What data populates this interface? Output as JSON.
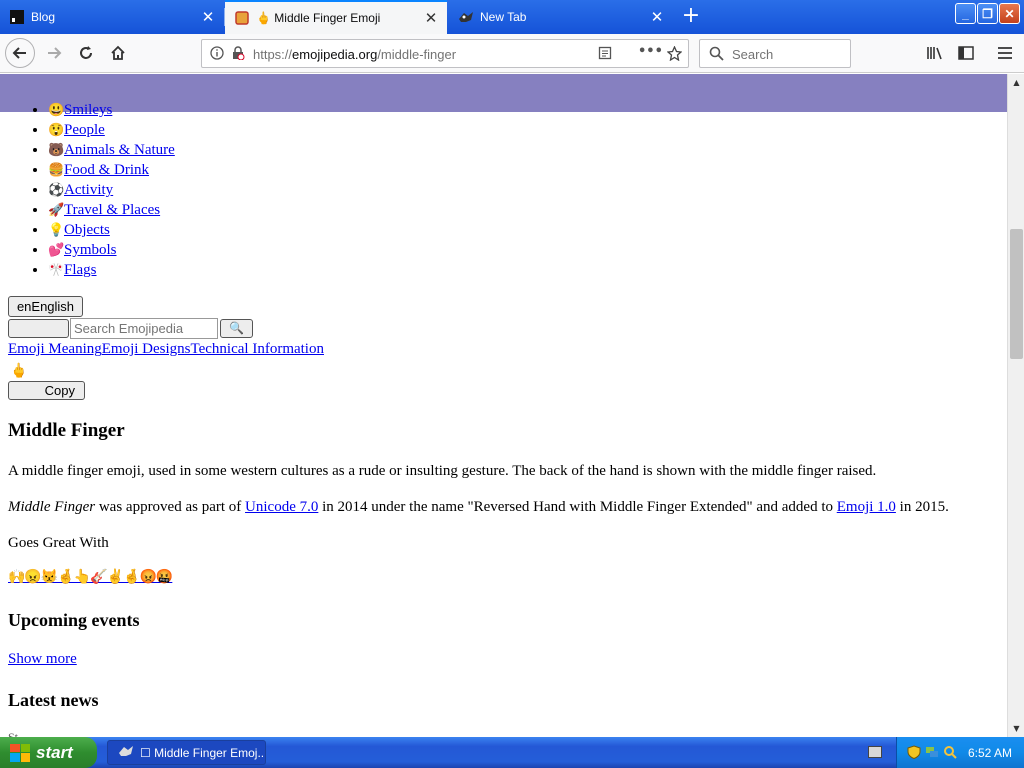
{
  "browser": {
    "tabs": [
      {
        "title": "Blog",
        "active": false,
        "icon": "blog-favicon"
      },
      {
        "title": "🖕 Middle Finger Emoji",
        "active": true,
        "icon": "emojipedia-favicon"
      },
      {
        "title": "New Tab",
        "active": false,
        "icon": "firefox-favicon"
      }
    ],
    "url": {
      "scheme": "https://",
      "host": "emojipedia.org",
      "path": "/middle-finger"
    },
    "search_placeholder": "Search"
  },
  "page": {
    "categories": [
      {
        "emoji": "😃",
        "label": "Smileys"
      },
      {
        "emoji": "😲",
        "label": "People"
      },
      {
        "emoji": "🐻",
        "label": "Animals & Nature"
      },
      {
        "emoji": "🍔",
        "label": "Food & Drink"
      },
      {
        "emoji": "⚽",
        "label": "Activity"
      },
      {
        "emoji": "🚀",
        "label": "Travel & Places"
      },
      {
        "emoji": "💡",
        "label": "Objects"
      },
      {
        "emoji": "💕",
        "label": "Symbols"
      },
      {
        "emoji": "🎌",
        "label": "Flags"
      }
    ],
    "language_button": "enEnglish",
    "search_placeholder": "Search Emojipedia",
    "search_go_icon": "🔍",
    "nav_tabs": [
      "Emoji Meaning",
      "Emoji Designs",
      "Technical Information"
    ],
    "emoji_glyph": "🖕",
    "copy_label": "Copy",
    "title": "Middle Finger",
    "description": "A middle finger emoji, used in some western cultures as a rude or insulting gesture. The back of the hand is shown with the middle finger raised.",
    "approved": {
      "name_italic": "Middle Finger",
      "part1": " was approved as part of ",
      "link1": "Unicode 7.0",
      "part2": " in 2014 under the name \"Reversed Hand with Middle Finger Extended\" and added to ",
      "link2": "Emoji 1.0",
      "part3": " in 2015."
    },
    "goes_great_with": "Goes Great With",
    "goes_great_emojis": "🙌😠😾🤞👆🎸✌🤞😡🤬",
    "upcoming_events": "Upcoming events",
    "show_more": "Show more",
    "latest_news": "Latest news",
    "cutoff_text": "St"
  },
  "taskbar": {
    "start_label": "start",
    "task_item": "☐ Middle Finger Emoj...",
    "clock": "6:52 AM"
  },
  "colors": {
    "header_purple": "#8680c0",
    "link": "#0000ee",
    "xp_blue": "#245ed8",
    "start_green": "#2f8d2f"
  }
}
